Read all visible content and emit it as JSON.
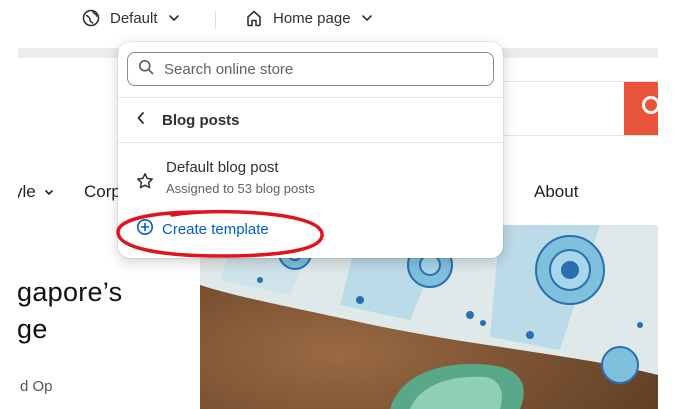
{
  "topbar": {
    "theme_label": "Default",
    "page_label": "Home page",
    "icons": [
      "globe-icon",
      "chevron-down-icon",
      "home-icon",
      "chevron-down-icon"
    ]
  },
  "storefront": {
    "nav_items": [
      "yle",
      "Corp",
      "About"
    ],
    "hero_title_lines": [
      "gapore’s",
      "ge"
    ],
    "hero_subtext": "d Op",
    "search_button_color": "#e8553b"
  },
  "popover": {
    "search_placeholder": "Search online store",
    "back_label": "Blog posts",
    "template": {
      "name": "Default blog post",
      "subtitle": "Assigned to 53 blog posts"
    },
    "create_label": "Create template",
    "accent_color": "#005bd3"
  },
  "annotation": {
    "color": "#e0141e",
    "marks": "circle around create template"
  }
}
